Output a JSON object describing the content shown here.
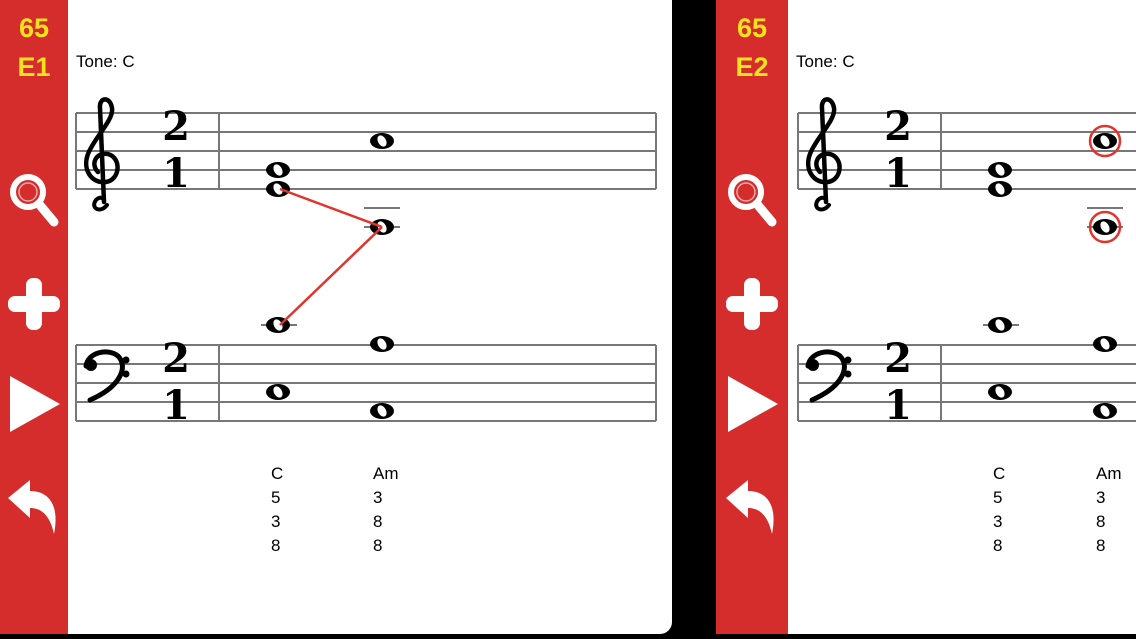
{
  "panels": [
    {
      "badge_number": "65",
      "badge_code": "E1",
      "tone_label": "Tone:",
      "tone_value": "C",
      "time_signature": {
        "top": "2",
        "bottom": "1"
      },
      "chords": [
        {
          "name": "C",
          "numbers": [
            "5",
            "3",
            "8"
          ]
        },
        {
          "name": "Am",
          "numbers": [
            "3",
            "8",
            "8"
          ]
        }
      ]
    },
    {
      "badge_number": "65",
      "badge_code": "E2",
      "tone_label": "Tone:",
      "tone_value": "C",
      "time_signature": {
        "top": "2",
        "bottom": "1"
      },
      "chords": [
        {
          "name": "C",
          "numbers": [
            "5",
            "3",
            "8"
          ]
        },
        {
          "name": "Am",
          "numbers": [
            "3",
            "8",
            "8"
          ]
        }
      ]
    }
  ],
  "sidebar_buttons": [
    "search-icon",
    "plus-icon",
    "play-icon",
    "undo-icon"
  ],
  "colors": {
    "sidebar": "#d52c2c",
    "badge_text": "#f3e31c",
    "voice_leading_line": "#e0342c",
    "highlight_circle": "#e0342c"
  }
}
